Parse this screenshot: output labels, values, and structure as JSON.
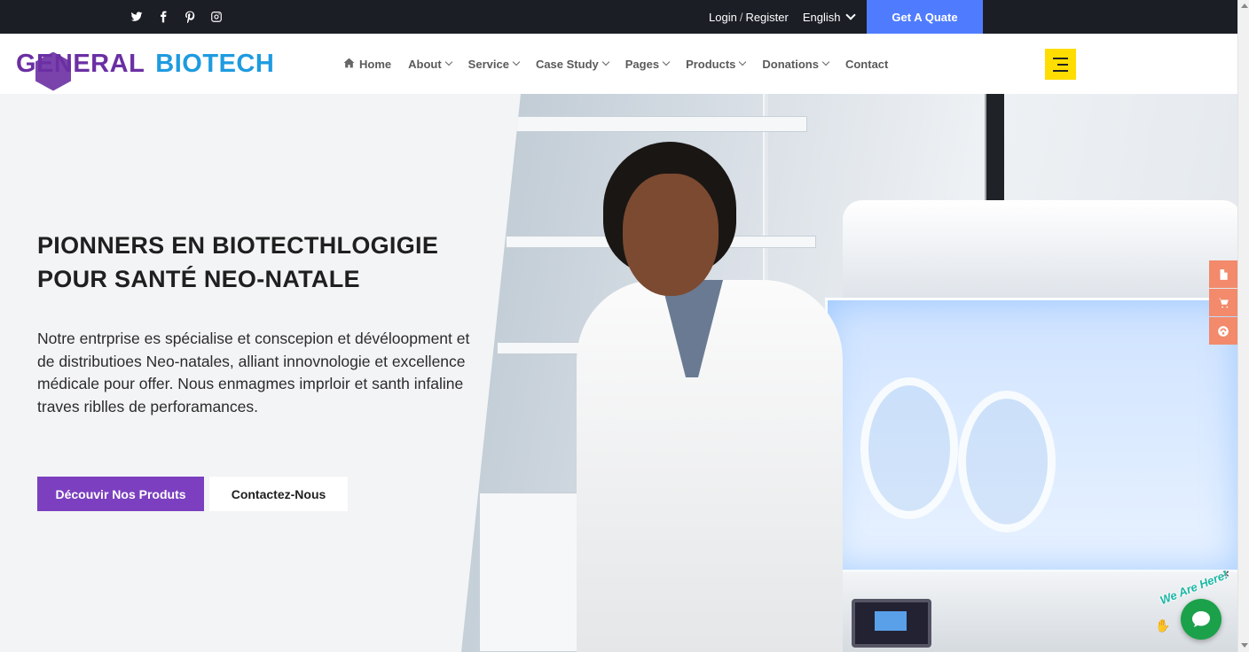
{
  "topbar": {
    "socials": [
      "twitter-icon",
      "facebook-icon",
      "pinterest-icon",
      "instagram-icon"
    ],
    "login": "Login",
    "register": "Register",
    "language": "English",
    "quote_button": "Get A Quate"
  },
  "nav": {
    "logo_part1": "GENERAL",
    "logo_part2": "BIOTECH",
    "items": [
      {
        "label": "Home"
      },
      {
        "label": "About"
      },
      {
        "label": "Service"
      },
      {
        "label": "Case Study"
      },
      {
        "label": "Pages"
      },
      {
        "label": "Products"
      },
      {
        "label": "Donations"
      },
      {
        "label": "Contact"
      }
    ]
  },
  "hero": {
    "title_line1": "PIONNERS EN BIOTECTHLOGIGIE",
    "title_line2": "POUR SANTÉ NEO-NATALE",
    "description": "Notre entrprise es spécialise et conscepion et dévéloopment et de distributioes Neo-natales, alliant innovnologie et excellence médicale pour offer. Nous enmagmes imprloir et santh infaline traves riblles de perforamances.",
    "primary_button": "Découvir Nos Produts",
    "secondary_button": "Contactez-Nous"
  },
  "chat": {
    "badge": "We Are Here!",
    "close": "×"
  },
  "colors": {
    "topbar_bg": "#1c1e26",
    "quote_button_bg": "#4f7cff",
    "logo_purple": "#6b2fa3",
    "logo_blue": "#1e9be0",
    "primary_button_bg": "#7b3fbf",
    "menu_button_bg": "#ffdd00",
    "side_tools_bg": "#f28a6b",
    "chat_green": "#1ba14a"
  }
}
